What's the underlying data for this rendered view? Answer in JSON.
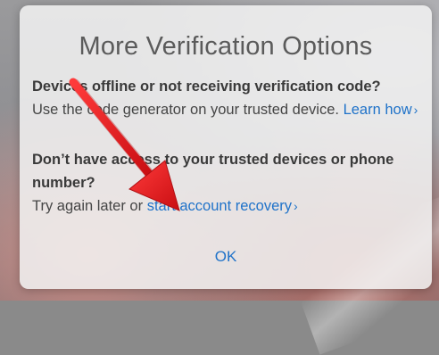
{
  "dialog": {
    "title": "More Verification Options",
    "section1": {
      "heading": "Devices offline or not receiving verification code?",
      "body": "Use the code generator on your trusted device.",
      "link": "Learn how"
    },
    "section2": {
      "heading": "Don’t have access to your trusted devices or phone number?",
      "body": "Try again later or",
      "link": "start account recovery"
    },
    "ok_label": "OK"
  },
  "icons": {
    "link_chevron": "›",
    "annotation": "red-arrow-icon"
  },
  "colors": {
    "link": "#1f72c9",
    "arrow": "#e0161a",
    "dialog_bg": "#f2f2f2",
    "title": "#5b5b5b"
  }
}
